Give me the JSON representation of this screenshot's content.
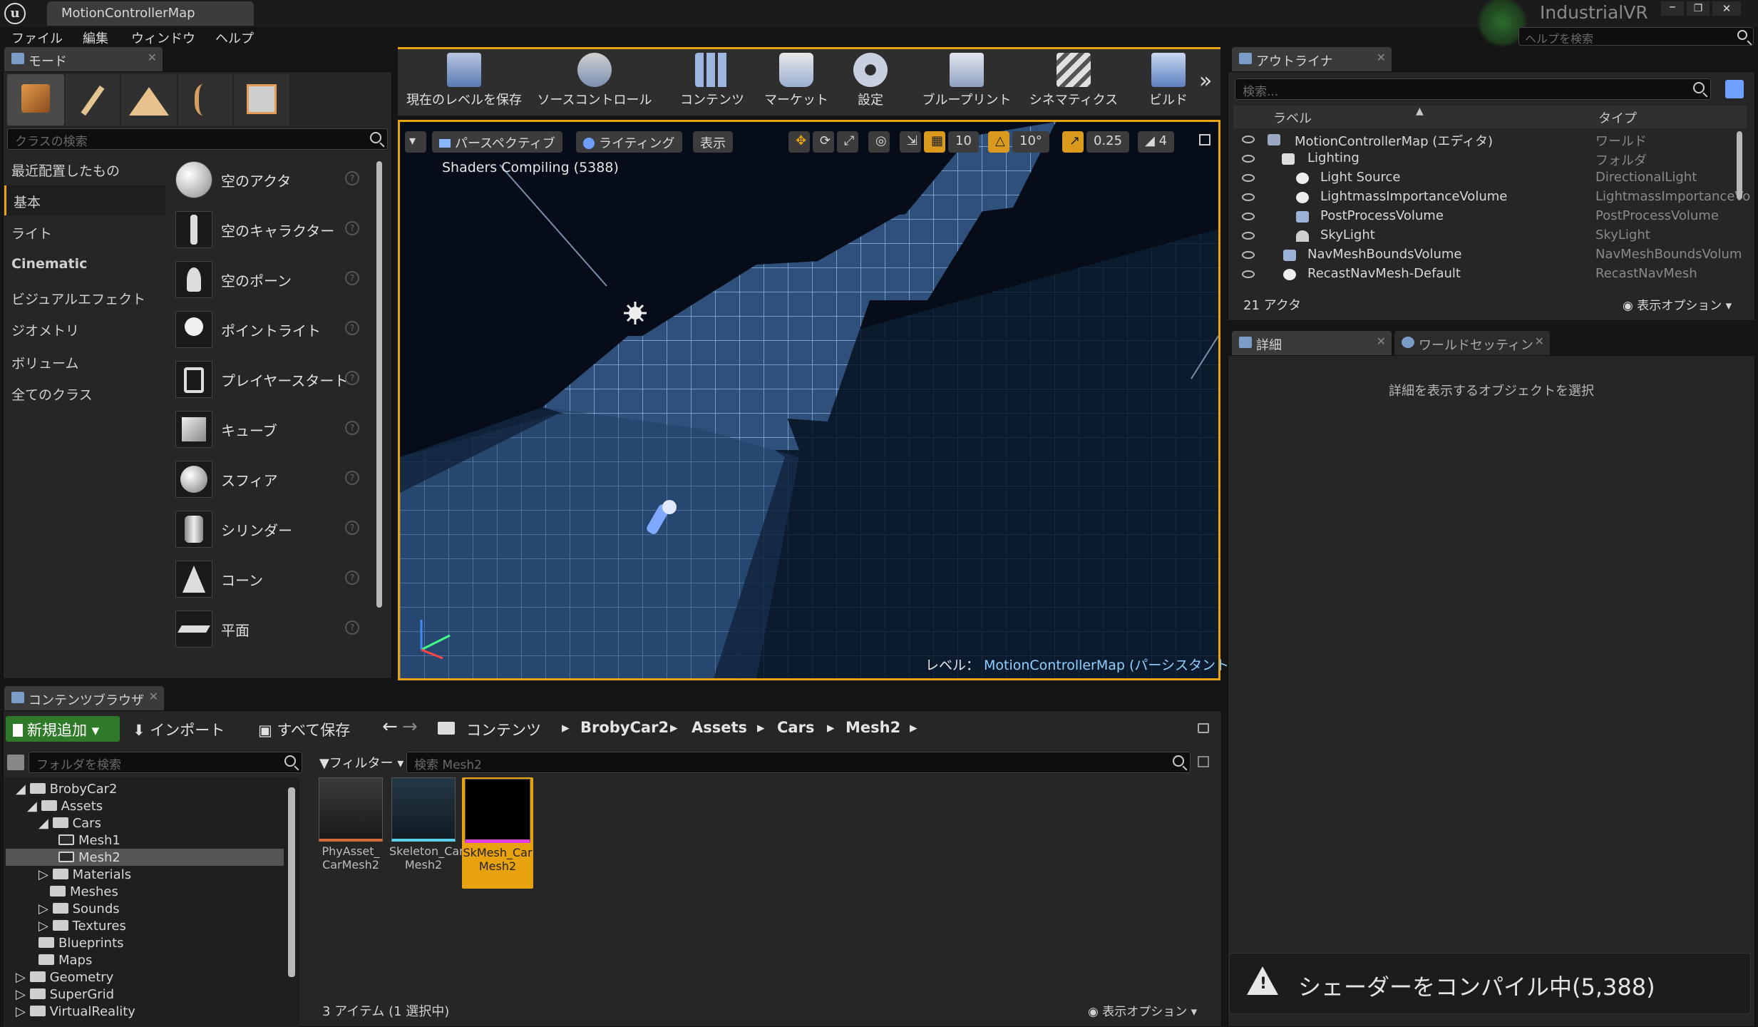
{
  "app": {
    "tab_title": "MotionControllerMap",
    "project": "IndustrialVR",
    "help_search_placeholder": "ヘルプを検索"
  },
  "menu": [
    "ファイル",
    "編集",
    "ウィンドウ",
    "ヘルプ"
  ],
  "modes": {
    "tab": "モード",
    "search_placeholder": "クラスの検索",
    "categories": [
      "最近配置したもの",
      "基本",
      "ライト",
      "Cinematic",
      "ビジュアルエフェクト",
      "ジオメトリ",
      "ボリューム",
      "全てのクラス"
    ],
    "selected_category": "基本",
    "items": [
      "空のアクタ",
      "空のキャラクター",
      "空のポーン",
      "ポイントライト",
      "プレイヤースタート",
      "キューブ",
      "スフィア",
      "シリンダー",
      "コーン",
      "平面"
    ]
  },
  "toolbar": {
    "buttons": [
      "現在のレベルを保存",
      "ソースコントロール",
      "コンテンツ",
      "マーケット",
      "設定",
      "ブループリント",
      "シネマティクス",
      "ビルド"
    ]
  },
  "viewport": {
    "perspective": "パースペクティブ",
    "lighting": "ライティング",
    "show": "表示",
    "grid_snap": "10",
    "rot_snap": "10°",
    "scale_snap": "0.25",
    "camera_speed": "4",
    "overlay": "Shaders Compiling (5388)",
    "level_label": "レベル：",
    "level_name": "MotionControllerMap (パーシスタント)"
  },
  "outliner": {
    "tab": "アウトライナ",
    "search_placeholder": "検索...",
    "col_label": "ラベル",
    "col_type": "タイプ",
    "rows": [
      {
        "label": "MotionControllerMap (エディタ)",
        "type": "ワールド"
      },
      {
        "label": "Lighting",
        "type": "フォルダ"
      },
      {
        "label": "Light Source",
        "type": "DirectionalLight"
      },
      {
        "label": "LightmassImportanceVolume",
        "type": "LightmassImportanceVo"
      },
      {
        "label": "PostProcessVolume",
        "type": "PostProcessVolume"
      },
      {
        "label": "SkyLight",
        "type": "SkyLight"
      },
      {
        "label": "NavMeshBoundsVolume",
        "type": "NavMeshBoundsVolum"
      },
      {
        "label": "RecastNavMesh-Default",
        "type": "RecastNavMesh"
      }
    ],
    "count": "21 アクタ",
    "view_options": "表示オプション"
  },
  "details": {
    "tab": "詳細",
    "world_tab": "ワールドセッティン",
    "empty_message": "詳細を表示するオブジェクトを選択"
  },
  "content_browser": {
    "tab": "コンテンツブラウザ",
    "add_new": "新規追加",
    "import": "インポート",
    "save_all": "すべて保存",
    "path": [
      "コンテンツ",
      "BrobyCar2",
      "Assets",
      "Cars",
      "Mesh2"
    ],
    "folder_search_placeholder": "フォルダを検索",
    "filter": "フィルター",
    "asset_search_placeholder": "検索 Mesh2",
    "tree": [
      "BrobyCar2",
      "Assets",
      "Cars",
      "Mesh1",
      "Mesh2",
      "Materials",
      "Meshes",
      "Sounds",
      "Textures",
      "Blueprints",
      "Maps",
      "Geometry",
      "SuperGrid",
      "VirtualReality"
    ],
    "assets": [
      {
        "line1": "PhyAsset_",
        "line2": "CarMesh2"
      },
      {
        "line1": "Skeleton_Car",
        "line2": "Mesh2"
      },
      {
        "line1": "SkMesh_Car",
        "line2": "Mesh2"
      }
    ],
    "status": "3 アイテム (1 選択中)",
    "view_options": "表示オプション"
  },
  "notification": "シェーダーをコンパイル中(5,388)",
  "colors": {
    "accent": "#e8a10f",
    "add_green": "#2f7a28",
    "link_blue": "#8fd0ff"
  }
}
